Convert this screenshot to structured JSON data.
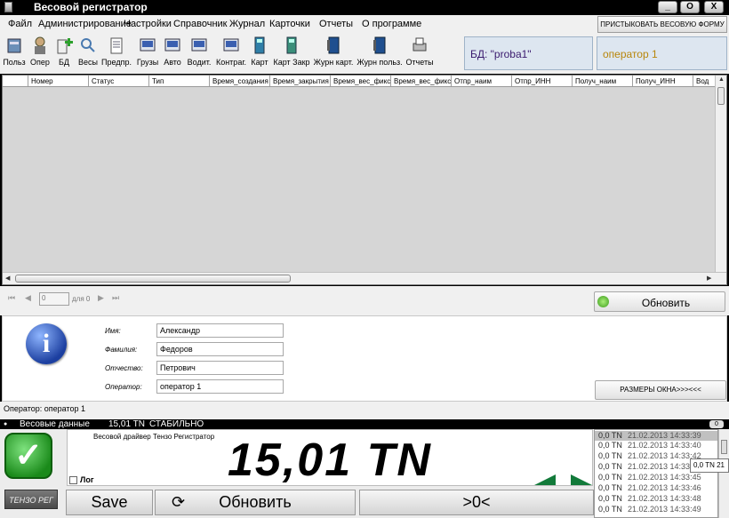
{
  "window": {
    "title": "Весовой регистратор",
    "controls": [
      "_",
      "O",
      "X"
    ]
  },
  "menu": {
    "items": [
      "Файл",
      "Администрирование",
      "Настройки",
      "Справочник",
      "Журнал",
      "Карточки",
      "Отчеты",
      "О программе"
    ],
    "dock_button": "ПРИСТЫКОВАТЬ ВЕСОВУЮ ФОРМУ"
  },
  "toolbar": {
    "tools": [
      {
        "label": "Польз",
        "icon": "users-icon"
      },
      {
        "label": "Опер",
        "icon": "operator-icon"
      },
      {
        "label": "БД",
        "icon": "database-add-icon"
      },
      {
        "label": "Весы",
        "icon": "scales-icon"
      },
      {
        "label": "Предпр.",
        "icon": "company-icon"
      },
      {
        "label": "Грузы",
        "icon": "cargo-icon"
      },
      {
        "label": "Авто",
        "icon": "truck-icon"
      },
      {
        "label": "Водит.",
        "icon": "driver-icon"
      },
      {
        "label": "Контраг.",
        "icon": "contractor-icon"
      },
      {
        "label": "Карт",
        "icon": "card-icon"
      },
      {
        "label": "Карт Закр",
        "icon": "card-closed-icon"
      },
      {
        "label": "Журн карт.",
        "icon": "card-journal-icon"
      },
      {
        "label": "Журн польз.",
        "icon": "user-journal-icon"
      },
      {
        "label": "Отчеты",
        "icon": "printer-icon"
      }
    ],
    "db_label": "БД:  \"proba1\"",
    "operator_label": "оператор 1"
  },
  "grid": {
    "columns": [
      "",
      "Номер",
      "Статус",
      "Тип",
      "Время_создания",
      "Время_закрытия",
      "Время_вес_фиксации",
      "Время_вес_фиксации",
      "Отпр_наим",
      "Отпр_ИНН",
      "Получ_наим",
      "Получ_ИНН",
      "Вод"
    ]
  },
  "navigator": {
    "first": "⏮",
    "prev": "◀",
    "position": "0",
    "of_text": "для 0",
    "next": "▶",
    "last": "⏭",
    "refresh_label": "Обновить"
  },
  "operator_info": {
    "fields": [
      {
        "label": "Имя:",
        "value": "Александр"
      },
      {
        "label": "Фамилия:",
        "value": "Федоров"
      },
      {
        "label": "Отчество:",
        "value": "Петрович"
      },
      {
        "label": "Оператор:",
        "value": "оператор 1"
      }
    ],
    "size_button": "РАЗМЕРЫ ОКНА>>><<<"
  },
  "status_bar": "Оператор: оператор 1",
  "weight_panel": {
    "title": "Весовые данные",
    "value": "15,01",
    "unit": "TN",
    "state": "СТАБИЛЬНО",
    "driver_text": "Весовой драйвер  Тензо Регистратор",
    "display_value": "15,01 TN",
    "log_label": "Лог",
    "logo_text": "ТЕНЗО РЕГ",
    "save_label": "Save",
    "refresh_label": "Обновить",
    "zero_label": ">0<",
    "log_entries": [
      {
        "w": "0,0 TN",
        "d": "21.02.2013 14:33:39"
      },
      {
        "w": "0,0 TN",
        "d": "21.02.2013 14:33:40"
      },
      {
        "w": "0,0 TN",
        "d": "21.02.2013 14:33:42"
      },
      {
        "w": "0,0 TN",
        "d": "21.02.2013 14:33:43"
      },
      {
        "w": "0,0 TN",
        "d": "21.02.2013 14:33:45"
      },
      {
        "w": "0,0 TN",
        "d": "21.02.2013 14:33:46"
      },
      {
        "w": "0,0 TN",
        "d": "21.02.2013 14:33:48"
      },
      {
        "w": "0,0 TN",
        "d": "21.02.2013 14:33:49"
      }
    ],
    "tooltip": "0,0 TN    21"
  },
  "colors": {
    "stable_green": "#1a8a1a",
    "accent_blue": "#1c3fa0",
    "panel_bg": "#dde6f0"
  }
}
